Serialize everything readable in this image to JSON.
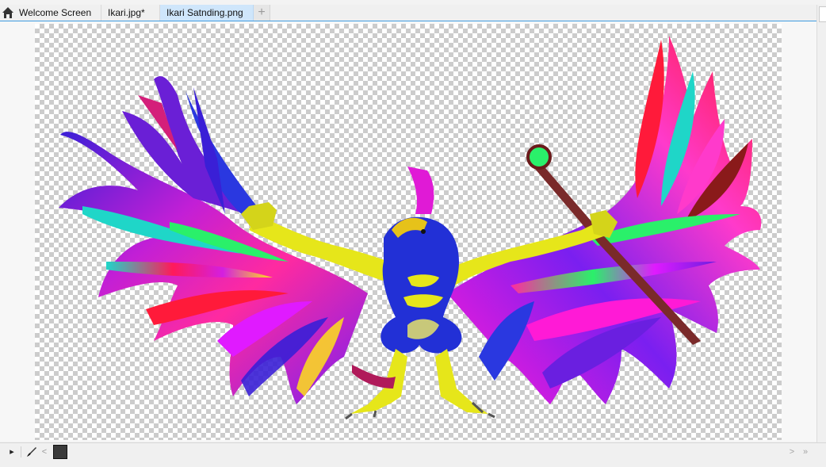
{
  "tabs": [
    {
      "label": "Welcome Screen",
      "icon": "home-icon",
      "active": false
    },
    {
      "label": "Ikari.jpg*",
      "active": false
    },
    {
      "label": "Ikari Satnding.png",
      "active": true
    }
  ],
  "tab_add_symbol": "+",
  "canvas": {
    "content": "ikari-bird-artwork",
    "background": "transparency-checkerboard"
  },
  "bottom_toolbar": {
    "play_symbol": "▸",
    "left_symbol": "<",
    "right_symbol": ">",
    "end_symbol": "»",
    "swatch_color": "#3a3a3a"
  },
  "colors": {
    "active_tab": "#cfe6fb",
    "tab_underline": "#3f9be0"
  }
}
